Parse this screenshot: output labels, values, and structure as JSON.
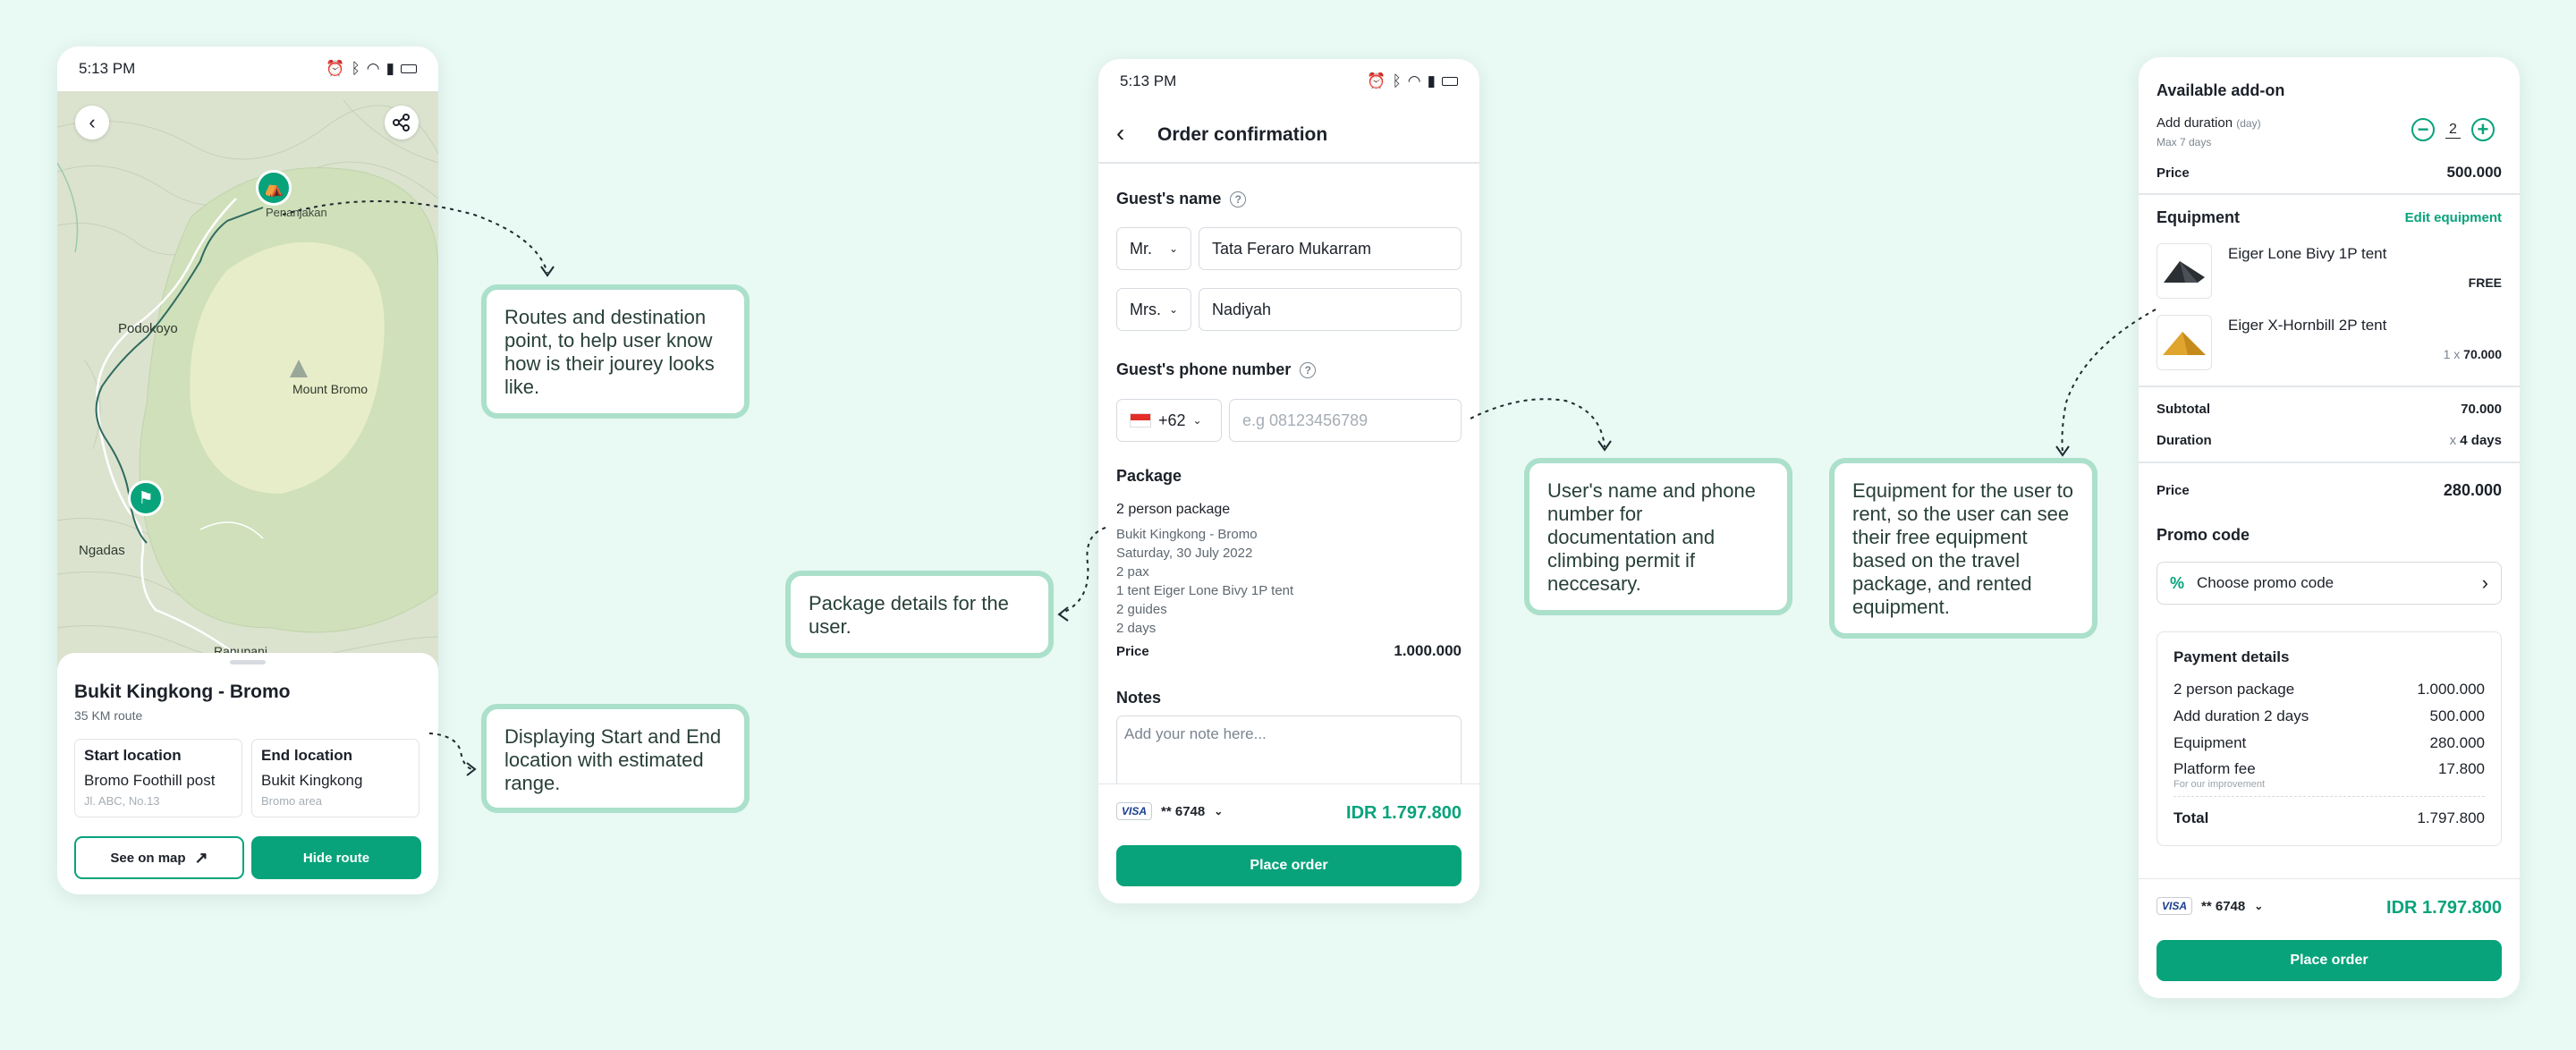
{
  "status_bar": {
    "time": "5:13 PM"
  },
  "screen_map": {
    "map_labels": {
      "pananjakan": "Penanjakan",
      "podokoyo": "Podokoyo",
      "mount_bromo": "Mount Bromo",
      "ngadas": "Ngadas",
      "bottom": "Ranupani"
    },
    "route_title": "Bukit Kingkong - Bromo",
    "route_distance": "35 KM route",
    "start": {
      "label": "Start location",
      "name": "Bromo Foothill post",
      "detail": "Jl. ABC, No.13"
    },
    "end": {
      "label": "End location",
      "name": "Bukit Kingkong",
      "detail": "Bromo area"
    },
    "see_on_map": "See on map",
    "hide_route": "Hide route"
  },
  "screen_order": {
    "title": "Order confirmation",
    "guest_name_label": "Guest's name",
    "guests": [
      {
        "salutation": "Mr.",
        "name": "Tata Feraro Mukarram"
      },
      {
        "salutation": "Mrs.",
        "name": "Nadiyah"
      }
    ],
    "phone_label": "Guest's phone number",
    "country_code": "+62",
    "phone_placeholder": "e.g 08123456789",
    "package_label": "Package",
    "package_name": "2 person package",
    "package_details": [
      "Bukit Kingkong - Bromo",
      "Saturday, 30 July 2022",
      "2 pax",
      "1 tent Eiger Lone Bivy 1P tent",
      "2 guides",
      "2 days"
    ],
    "price_label": "Price",
    "price": "1.000.000",
    "notes_label": "Notes",
    "notes_placeholder": "Add your note here...",
    "card_brand": "VISA",
    "card_last": "** 6748",
    "total": "IDR 1.797.800",
    "place_order": "Place order"
  },
  "screen_addon": {
    "title": "Available add-on",
    "add_duration_label": "Add duration",
    "add_duration_unit": "(day)",
    "add_duration_max": "Max 7 days",
    "duration_value": "2",
    "price_label": "Price",
    "price": "500.000",
    "equipment_label": "Equipment",
    "edit_equipment": "Edit equipment",
    "equipment": [
      {
        "name": "Eiger Lone Bivy 1P tent",
        "price": "FREE",
        "qty": ""
      },
      {
        "name": "Eiger X-Hornbill 2P tent",
        "price": "70.000",
        "qty": "1 x"
      }
    ],
    "subtotal_label": "Subtotal",
    "subtotal": "70.000",
    "duration_label": "Duration",
    "duration_mult": "x",
    "duration_days": "4 days",
    "total_price_label": "Price",
    "total_price": "280.000",
    "promo_label": "Promo code",
    "promo_button": "Choose promo code",
    "payment_title": "Payment details",
    "payment_rows": [
      {
        "label": "2 person package",
        "value": "1.000.000"
      },
      {
        "label": "Add duration 2 days",
        "value": "500.000"
      },
      {
        "label": "Equipment",
        "value": "280.000"
      },
      {
        "label": "Platform fee",
        "value": "17.800"
      }
    ],
    "platform_fee_note": "For our improvement",
    "total_label": "Total",
    "total_value": "1.797.800",
    "card_brand": "VISA",
    "card_last": "** 6748",
    "pay_total": "IDR 1.797.800",
    "place_order": "Place order"
  },
  "callouts": {
    "route": "Routes and destination point, to help user know how is their jourey looks like.",
    "locations": "Displaying Start and End location with estimated range.",
    "package": "Package details for the user.",
    "name_phone": "User's name and phone number for documentation and climbing permit if neccesary.",
    "equipment": "Equipment for the user to rent, so the user can see their free equipment based on the travel package, and rented equipment."
  },
  "colors": {
    "accent": "#08a37b",
    "background": "#e9f9f3",
    "callout_border": "#abe0cb"
  }
}
